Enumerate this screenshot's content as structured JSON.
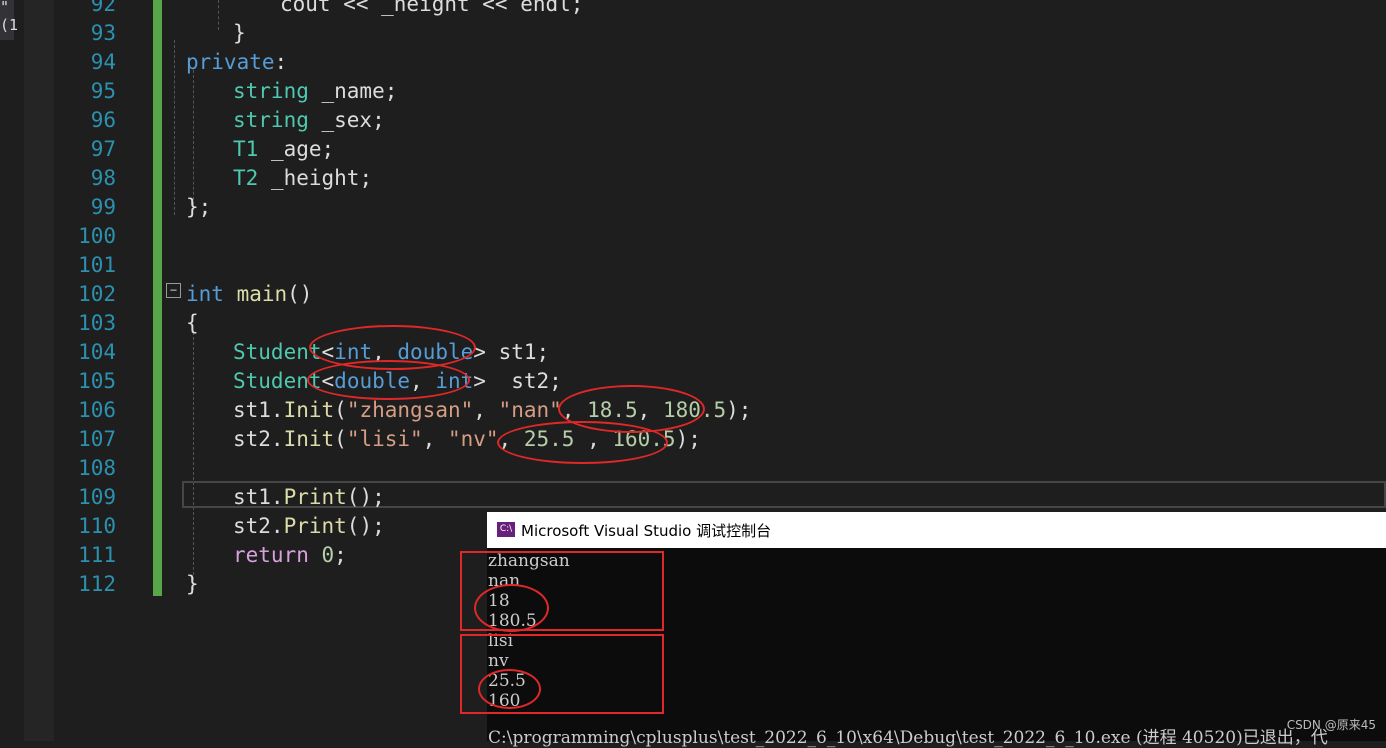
{
  "left_fragment": "\"(1",
  "line_numbers": [
    "92",
    "93",
    "94",
    "95",
    "96",
    "97",
    "98",
    "99",
    "100",
    "101",
    "102",
    "103",
    "104",
    "105",
    "106",
    "107",
    "108",
    "109",
    "110",
    "111",
    "112"
  ],
  "code": {
    "l92": "cout << _height << endl;",
    "l93": "}",
    "l94_kw": "private",
    "l94_p": ":",
    "l95_t": "string",
    "l95_v": " _name;",
    "l96_t": "string",
    "l96_v": " _sex;",
    "l97_t": "T1",
    "l97_v": " _age;",
    "l98_t": "T2",
    "l98_v": " _height;",
    "l99": "};",
    "l102_kw": "int",
    "l102_fn": " main",
    "l102_p": "()",
    "l103": "{",
    "l104_t": "Student",
    "l104_a": "<",
    "l104_k1": "int",
    "l104_c": ", ",
    "l104_k2": "double",
    "l104_b": ">",
    "l104_v": " st1;",
    "l105_t": "Student",
    "l105_a": "<",
    "l105_k1": "double",
    "l105_c": ", ",
    "l105_k2": "int",
    "l105_b": ">",
    "l105_v": "  st2;",
    "l106_v": "st1.",
    "l106_fn": "Init",
    "l106_o": "(",
    "l106_s1": "\"zhangsan\"",
    "l106_c1": ", ",
    "l106_s2": "\"nan\"",
    "l106_c2": ", ",
    "l106_n1": "18.5",
    "l106_c3": ", ",
    "l106_n2": "180.5",
    "l106_e": ");",
    "l107_v": "st2.",
    "l107_fn": "Init",
    "l107_o": "(",
    "l107_s1": "\"lisi\"",
    "l107_c1": ", ",
    "l107_s2": "\"nv\"",
    "l107_c2": ", ",
    "l107_n1": "25.5",
    "l107_c3": " , ",
    "l107_n2": "160.5",
    "l107_e": ");",
    "l109_v": "st1.",
    "l109_fn": "Print",
    "l109_e": "();",
    "l110_v": "st2.",
    "l110_fn": "Print",
    "l110_e": "();",
    "l111_kw": "return",
    "l111_n": " 0",
    "l111_e": ";",
    "l112": "}"
  },
  "console": {
    "title": "Microsoft Visual Studio 调试控制台",
    "icon": "C:\\",
    "lines": [
      "zhangsan",
      "nan",
      "18",
      "180.5",
      "lisi",
      "nv",
      "25.5",
      "160"
    ],
    "exit_line": "C:\\programming\\cplusplus\\test_2022_6_10\\x64\\Debug\\test_2022_6_10.exe (进程 40520)已退出，代"
  },
  "watermark": "CSDN @原来45",
  "colors": {
    "background": "#1e1e1e",
    "line_number": "#2b91af",
    "keyword": "#569cd6",
    "type": "#4ec9b0",
    "string": "#d69d85",
    "number": "#b5cea8",
    "function": "#dcdcaa",
    "annotation": "#e02828",
    "change_bar": "#57a64a"
  }
}
